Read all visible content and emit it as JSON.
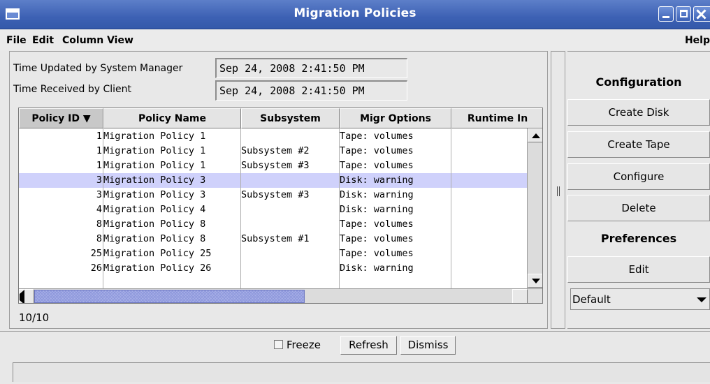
{
  "window": {
    "title": "Migration Policies",
    "accent_color": "#3d61b4",
    "controls": [
      "minimize-icon",
      "maximize-icon",
      "close-icon"
    ]
  },
  "menubar": {
    "file": "File",
    "edit": "Edit",
    "column_view": "Column View",
    "help": "Help"
  },
  "info": {
    "updated_label": "Time Updated by System Manager",
    "updated_value": "Sep 24, 2008 2:41:50 PM",
    "received_label": "Time Received by Client",
    "received_value": "Sep 24, 2008 2:41:50 PM"
  },
  "table": {
    "columns": [
      "Policy ID ▼",
      "Policy Name",
      "Subsystem",
      "Migr Options",
      "Runtime In"
    ],
    "selected_row": 3,
    "selection_color": "#cfd1fb",
    "rows": [
      {
        "id": "1",
        "name": "Migration Policy 1",
        "subsystem": "",
        "migr": "Tape: volumes",
        "runtime": ""
      },
      {
        "id": "1",
        "name": "Migration Policy 1",
        "subsystem": "Subsystem #2",
        "migr": "Tape: volumes",
        "runtime": ""
      },
      {
        "id": "1",
        "name": "Migration Policy 1",
        "subsystem": "Subsystem #3",
        "migr": "Tape: volumes",
        "runtime": ""
      },
      {
        "id": "3",
        "name": "Migration Policy 3",
        "subsystem": "",
        "migr": "Disk: warning",
        "runtime": ""
      },
      {
        "id": "3",
        "name": "Migration Policy 3",
        "subsystem": "Subsystem #3",
        "migr": "Disk: warning",
        "runtime": ""
      },
      {
        "id": "4",
        "name": "Migration Policy 4",
        "subsystem": "",
        "migr": "Disk: warning",
        "runtime": ""
      },
      {
        "id": "8",
        "name": "Migration Policy 8",
        "subsystem": "",
        "migr": "Tape: volumes",
        "runtime": ""
      },
      {
        "id": "8",
        "name": "Migration Policy 8",
        "subsystem": "Subsystem #1",
        "migr": "Tape: volumes",
        "runtime": ""
      },
      {
        "id": "25",
        "name": "Migration Policy 25",
        "subsystem": "",
        "migr": "Tape: volumes",
        "runtime": ""
      },
      {
        "id": "26",
        "name": "Migration Policy 26",
        "subsystem": "",
        "migr": "Disk: warning",
        "runtime": ""
      }
    ],
    "count": "10/10"
  },
  "side": {
    "configuration_title": "Configuration",
    "create_disk": "Create Disk",
    "create_tape": "Create Tape",
    "configure": "Configure",
    "delete": "Delete",
    "preferences_title": "Preferences",
    "edit": "Edit",
    "preference_selected": "Default"
  },
  "footer": {
    "freeze": "Freeze",
    "refresh": "Refresh",
    "dismiss": "Dismiss"
  }
}
